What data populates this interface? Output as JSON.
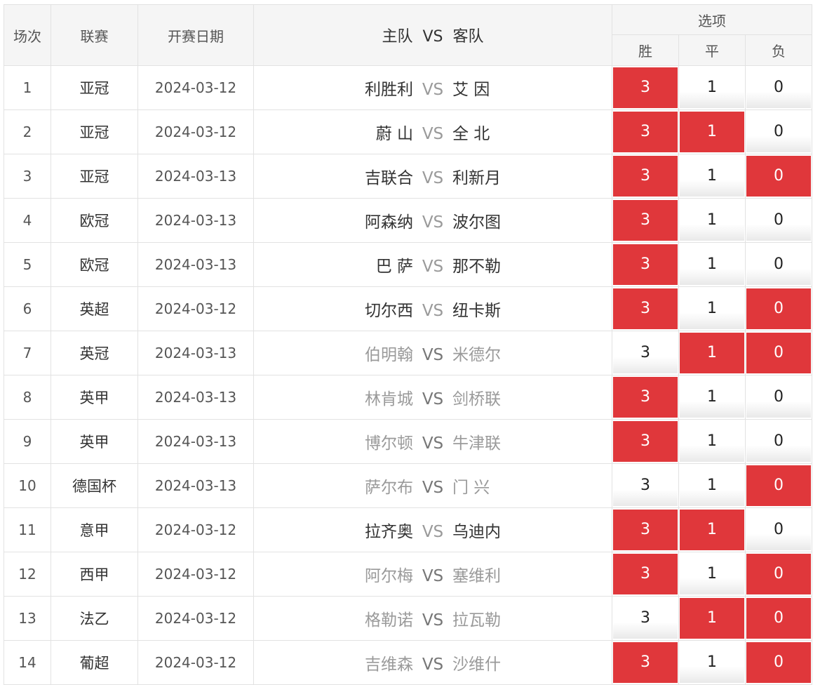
{
  "header": {
    "idx": "场次",
    "league": "联赛",
    "date": "开赛日期",
    "match": "主队  VS  客队",
    "options": "选项",
    "win": "胜",
    "draw": "平",
    "lose": "负"
  },
  "colors": {
    "selected": "#e0373b",
    "muted_team": "#9a9a9a"
  },
  "rows": [
    {
      "idx": "1",
      "league": "亚冠",
      "date": "2024-03-12",
      "home": "利胜利",
      "vs": "VS",
      "away": "艾 因",
      "muted": false,
      "w": "3",
      "d": "1",
      "l": "0",
      "sel": [
        true,
        false,
        false
      ]
    },
    {
      "idx": "2",
      "league": "亚冠",
      "date": "2024-03-12",
      "home": "蔚 山",
      "vs": "VS",
      "away": "全 北",
      "muted": false,
      "w": "3",
      "d": "1",
      "l": "0",
      "sel": [
        true,
        true,
        false
      ]
    },
    {
      "idx": "3",
      "league": "亚冠",
      "date": "2024-03-13",
      "home": "吉联合",
      "vs": "VS",
      "away": "利新月",
      "muted": false,
      "w": "3",
      "d": "1",
      "l": "0",
      "sel": [
        true,
        false,
        true
      ]
    },
    {
      "idx": "4",
      "league": "欧冠",
      "date": "2024-03-13",
      "home": "阿森纳",
      "vs": "VS",
      "away": "波尔图",
      "muted": false,
      "w": "3",
      "d": "1",
      "l": "0",
      "sel": [
        true,
        false,
        false
      ]
    },
    {
      "idx": "5",
      "league": "欧冠",
      "date": "2024-03-13",
      "home": "巴 萨",
      "vs": "VS",
      "away": "那不勒",
      "muted": false,
      "w": "3",
      "d": "1",
      "l": "0",
      "sel": [
        true,
        false,
        false
      ]
    },
    {
      "idx": "6",
      "league": "英超",
      "date": "2024-03-12",
      "home": "切尔西",
      "vs": "VS",
      "away": "纽卡斯",
      "muted": false,
      "w": "3",
      "d": "1",
      "l": "0",
      "sel": [
        true,
        false,
        true
      ]
    },
    {
      "idx": "7",
      "league": "英冠",
      "date": "2024-03-13",
      "home": "伯明翰",
      "vs": "VS",
      "away": "米德尔",
      "muted": true,
      "w": "3",
      "d": "1",
      "l": "0",
      "sel": [
        false,
        true,
        true
      ]
    },
    {
      "idx": "8",
      "league": "英甲",
      "date": "2024-03-13",
      "home": "林肯城",
      "vs": "VS",
      "away": "剑桥联",
      "muted": true,
      "w": "3",
      "d": "1",
      "l": "0",
      "sel": [
        true,
        false,
        false
      ]
    },
    {
      "idx": "9",
      "league": "英甲",
      "date": "2024-03-13",
      "home": "博尔顿",
      "vs": "VS",
      "away": "牛津联",
      "muted": true,
      "w": "3",
      "d": "1",
      "l": "0",
      "sel": [
        true,
        false,
        false
      ]
    },
    {
      "idx": "10",
      "league": "德国杯",
      "date": "2024-03-13",
      "home": "萨尔布",
      "vs": "VS",
      "away": "门 兴",
      "muted": true,
      "w": "3",
      "d": "1",
      "l": "0",
      "sel": [
        false,
        false,
        true
      ]
    },
    {
      "idx": "11",
      "league": "意甲",
      "date": "2024-03-12",
      "home": "拉齐奥",
      "vs": "VS",
      "away": "乌迪内",
      "muted": false,
      "w": "3",
      "d": "1",
      "l": "0",
      "sel": [
        true,
        true,
        false
      ]
    },
    {
      "idx": "12",
      "league": "西甲",
      "date": "2024-03-12",
      "home": "阿尔梅",
      "vs": "VS",
      "away": "塞维利",
      "muted": true,
      "w": "3",
      "d": "1",
      "l": "0",
      "sel": [
        true,
        false,
        true
      ]
    },
    {
      "idx": "13",
      "league": "法乙",
      "date": "2024-03-12",
      "home": "格勒诺",
      "vs": "VS",
      "away": "拉瓦勒",
      "muted": true,
      "w": "3",
      "d": "1",
      "l": "0",
      "sel": [
        false,
        true,
        true
      ]
    },
    {
      "idx": "14",
      "league": "葡超",
      "date": "2024-03-12",
      "home": "吉维森",
      "vs": "VS",
      "away": "沙维什",
      "muted": true,
      "w": "3",
      "d": "1",
      "l": "0",
      "sel": [
        true,
        false,
        true
      ]
    }
  ]
}
